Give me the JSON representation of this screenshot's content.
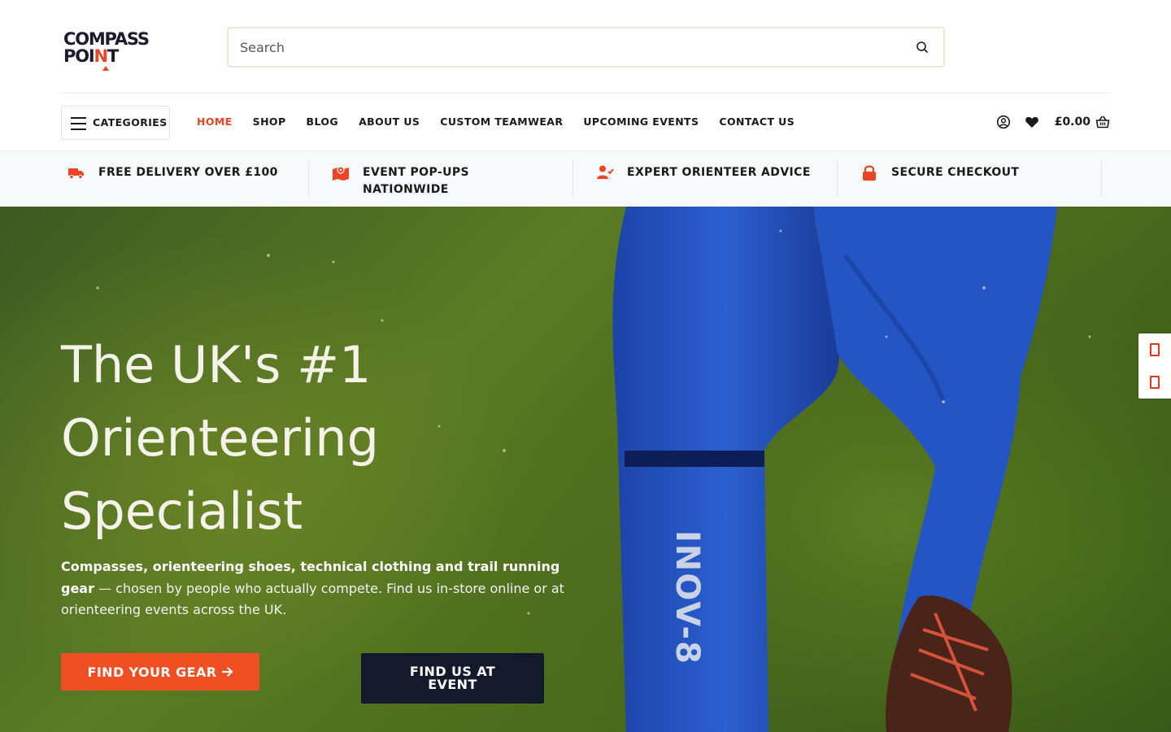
{
  "brand": {
    "line1": "COMPASS",
    "line2_a": "POI",
    "line2_b": "N",
    "line2_c": "T"
  },
  "search": {
    "placeholder": "Search"
  },
  "nav": {
    "categories_label": "CATEGORIES",
    "items": [
      {
        "label": "HOME",
        "active": true
      },
      {
        "label": "SHOP"
      },
      {
        "label": "BLOG"
      },
      {
        "label": "ABOUT US"
      },
      {
        "label": "CUSTOM TEAMWEAR"
      },
      {
        "label": "UPCOMING EVENTS"
      },
      {
        "label": "CONTACT US"
      }
    ],
    "cart_total": "£0.00",
    "icons": [
      "user-icon",
      "heart-icon",
      "basket-icon"
    ]
  },
  "usps": [
    {
      "icon": "truck-icon",
      "text": "FREE DELIVERY OVER £100"
    },
    {
      "icon": "map-pin-icon",
      "text": "EVENT POP-UPS NATIONWIDE"
    },
    {
      "icon": "user-check-icon",
      "text": "EXPERT ORIENTEER ADVICE"
    },
    {
      "icon": "lock-icon",
      "text": "SECURE CHECKOUT"
    }
  ],
  "hero": {
    "title": "The UK's #1 Orienteering Specialist",
    "desc_bold": "Compasses, orienteering shoes, technical clothing and trail running gear",
    "desc_rest": " — chosen by people who actually compete. Find us in-store online or at orienteering events across the UK.",
    "primary_cta": "FIND YOUR GEAR",
    "secondary_cta": "FIND US AT EVENT"
  },
  "colors": {
    "accent": "#ef4423",
    "dark": "#141a2c",
    "usp_bg": "#f7f9fb"
  }
}
